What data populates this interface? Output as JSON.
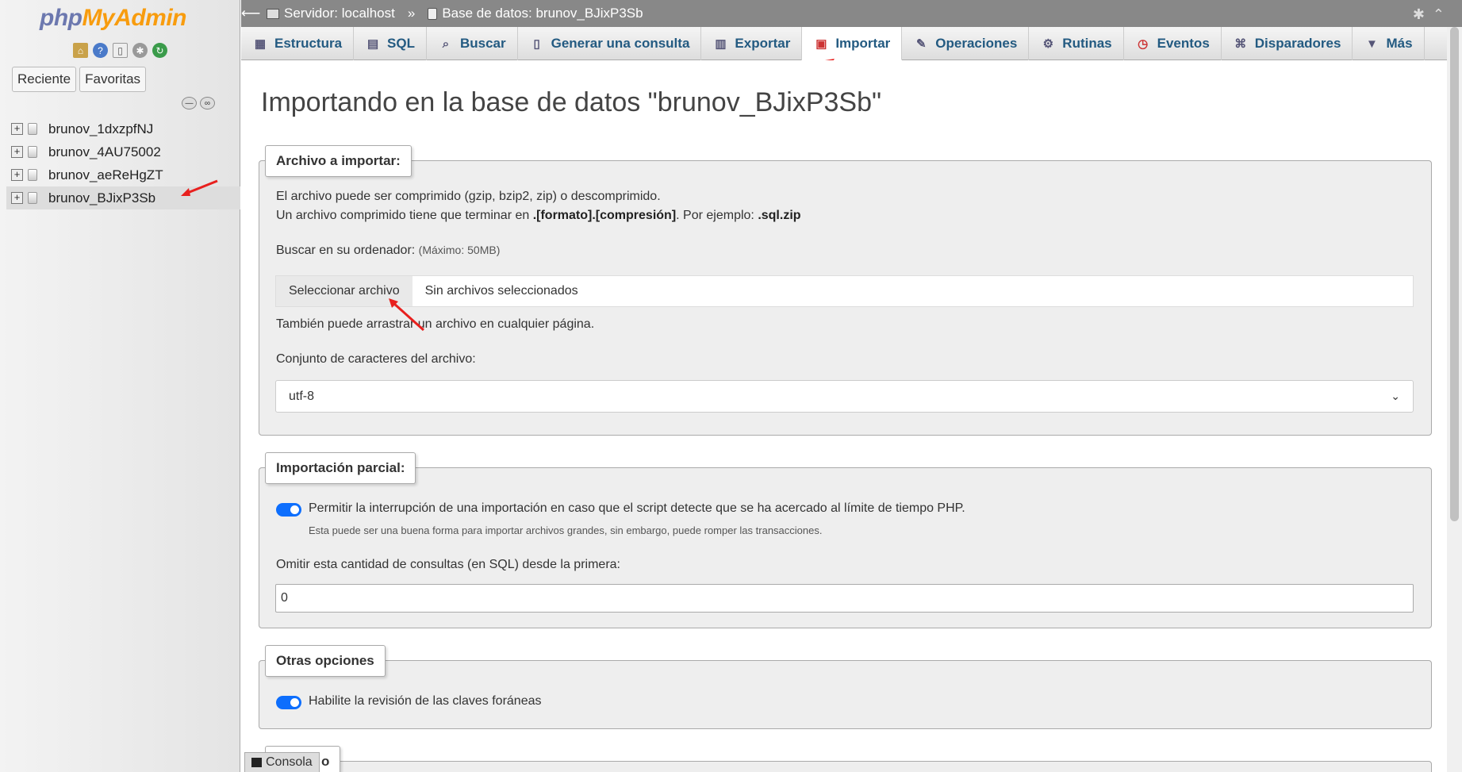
{
  "app": {
    "logo_php": "php",
    "logo_myadmin": "MyAdmin"
  },
  "sidebar": {
    "tabs": [
      "Reciente",
      "Favoritas"
    ],
    "databases": [
      {
        "name": "brunov_1dxzpfNJ"
      },
      {
        "name": "brunov_4AU75002"
      },
      {
        "name": "brunov_aeReHgZT"
      },
      {
        "name": "brunov_BJixP3Sb"
      }
    ]
  },
  "topbar": {
    "server": "Servidor: localhost",
    "separator": "»",
    "database": "Base de datos: brunov_BJixP3Sb"
  },
  "tabs": [
    {
      "label": "Estructura",
      "icon": "structure-icon"
    },
    {
      "label": "SQL",
      "icon": "sql-icon"
    },
    {
      "label": "Buscar",
      "icon": "search-icon"
    },
    {
      "label": "Generar una consulta",
      "icon": "query-icon"
    },
    {
      "label": "Exportar",
      "icon": "export-icon"
    },
    {
      "label": "Importar",
      "icon": "import-icon"
    },
    {
      "label": "Operaciones",
      "icon": "wrench-icon"
    },
    {
      "label": "Rutinas",
      "icon": "routines-icon"
    },
    {
      "label": "Eventos",
      "icon": "clock-icon"
    },
    {
      "label": "Disparadores",
      "icon": "triggers-icon"
    },
    {
      "label": "Más",
      "icon": "caret-down-icon"
    }
  ],
  "main": {
    "title": "Importando en la base de datos \"brunov_BJixP3Sb\"",
    "file_section": {
      "legend": "Archivo a importar:",
      "line1": "El archivo puede ser comprimido (gzip, bzip2, zip) o descomprimido.",
      "line2_pre": "Un archivo comprimido tiene que terminar en ",
      "line2_bold": ".[formato].[compresión]",
      "line2_mid": ". Por ejemplo: ",
      "line2_example": ".sql.zip",
      "browse_label": "Buscar en su ordenador:",
      "browse_max": "(Máximo: 50MB)",
      "file_button": "Seleccionar archivo",
      "file_status": "Sin archivos seleccionados",
      "drag_hint": "También puede arrastrar un archivo en cualquier página.",
      "charset_label": "Conjunto de caracteres del archivo:",
      "charset_value": "utf-8"
    },
    "partial_section": {
      "legend": "Importación parcial:",
      "allow_interrupt": "Permitir la interrupción de una importación en caso que el script detecte que se ha acercado al límite de tiempo PHP.",
      "allow_interrupt_hint": "Esta puede ser una buena forma para importar archivos grandes, sin embargo, puede romper las transacciones.",
      "skip_label": "Omitir esta cantidad de consultas (en SQL) desde la primera:",
      "skip_value": "0"
    },
    "other_section": {
      "legend": "Otras opciones",
      "foreign_keys": "Habilite la revisión de las claves foráneas"
    },
    "next_legend_partial": "o"
  },
  "console": {
    "label": "Consola"
  },
  "colors": {
    "accent": "#235a81",
    "toggle": "#0d6efd",
    "annotation_arrow": "#e8201e"
  }
}
